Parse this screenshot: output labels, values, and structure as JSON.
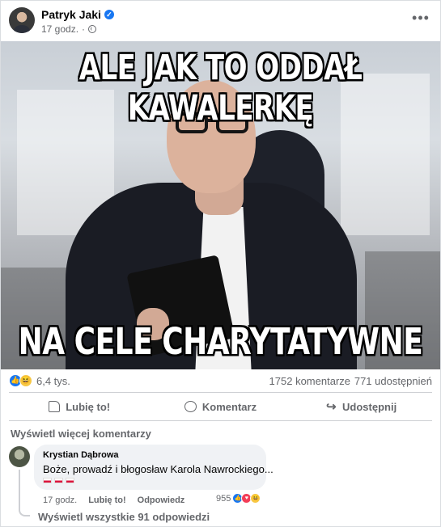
{
  "post": {
    "author": "Patryk Jaki",
    "time": "17 godz.",
    "visibility_icon": "globe-icon",
    "image_text_top": "ALE JAK TO ODDAŁ KAWALERKĘ",
    "image_text_bottom": "NA CELE CHARYTATYWNE"
  },
  "stats": {
    "reactions": "6,4 tys.",
    "comments": "1752 komentarze",
    "shares": "771 udostępnień"
  },
  "actions": {
    "like": "Lubię to!",
    "comment": "Komentarz",
    "share": "Udostępnij"
  },
  "comments": {
    "more_label": "Wyświetl więcej komentarzy",
    "items": [
      {
        "author": "Krystian Dąbrowa",
        "text": "Boże, prowadź i błogosław Karola Nawrockiego...",
        "time": "17 godz.",
        "like_label": "Lubię to!",
        "reply_label": "Odpowiedz",
        "reaction_count": "955"
      }
    ],
    "view_replies": "Wyświetl wszystkie 91 odpowiedzi"
  },
  "colors": {
    "accent": "#1877f2",
    "secondary_text": "#65676b",
    "bubble": "#f0f2f5"
  }
}
